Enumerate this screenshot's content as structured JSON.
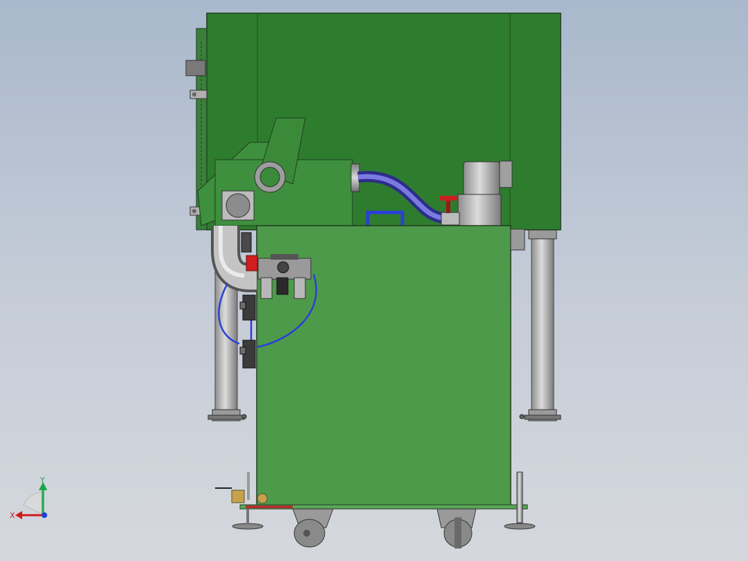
{
  "scene": {
    "colors": {
      "background_top": "#a9b8cc",
      "background_bottom": "#d5d8dd",
      "upper_housing": "#2e7d2e",
      "lower_cabinet": "#4d9a4a",
      "frame_edge": "#1f3d1f",
      "metal": "#a8a8a8",
      "hose": "#4444bb",
      "air_line": "#2b3fd6",
      "valve_handle": "#cc1f1f",
      "caster": "#8a8a8a"
    },
    "icons": [
      "coordinate-triad-icon",
      "valve-handle-icon",
      "caster-wheel-icon"
    ]
  },
  "triad": {
    "x_label": "X",
    "y_label": "Y",
    "x_color": "#d11a1a",
    "y_color": "#18a84a",
    "z_color": "#1a3fd1"
  }
}
